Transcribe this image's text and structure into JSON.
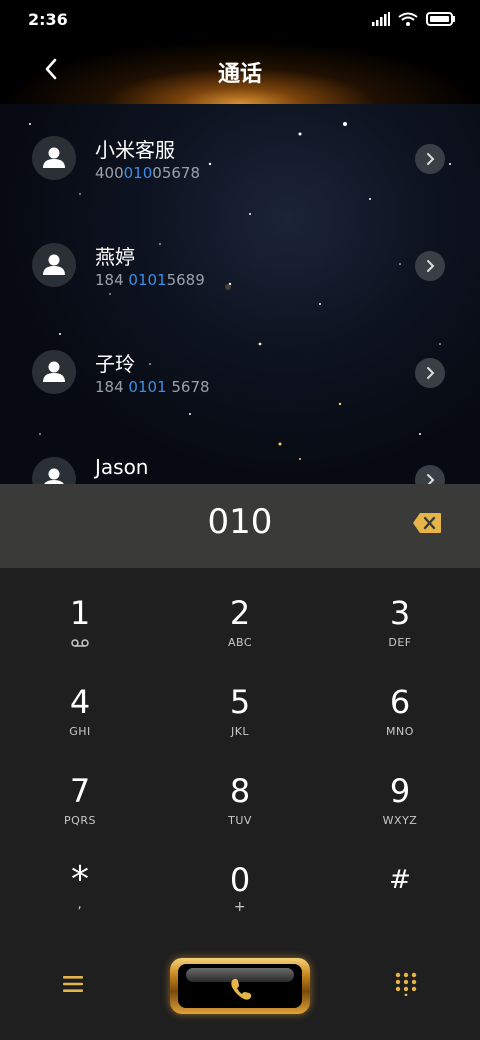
{
  "status": {
    "time": "2:36"
  },
  "header": {
    "title": "通话"
  },
  "contacts": [
    {
      "name": "小米客服",
      "num_pre": "400",
      "num_hl": "010",
      "num_post": "05678"
    },
    {
      "name": "燕婷",
      "num_pre": "184 ",
      "num_hl": "0101",
      "num_post": "5689"
    },
    {
      "name": "子玲",
      "num_pre": "184 ",
      "num_hl": "0101",
      "num_post": " 5678"
    },
    {
      "name": "Jason",
      "num_pre": "",
      "num_hl": "",
      "num_post": ""
    }
  ],
  "dialed": {
    "number": "010"
  },
  "keypad": [
    {
      "digit": "1",
      "letters": ""
    },
    {
      "digit": "2",
      "letters": "ABC"
    },
    {
      "digit": "3",
      "letters": "DEF"
    },
    {
      "digit": "4",
      "letters": "GHI"
    },
    {
      "digit": "5",
      "letters": "JKL"
    },
    {
      "digit": "6",
      "letters": "MNO"
    },
    {
      "digit": "7",
      "letters": "PQRS"
    },
    {
      "digit": "8",
      "letters": "TUV"
    },
    {
      "digit": "9",
      "letters": "WXYZ"
    },
    {
      "digit": "*",
      "letters": ","
    },
    {
      "digit": "0",
      "letters": "+"
    },
    {
      "digit": "#",
      "letters": ""
    }
  ],
  "colors": {
    "highlight": "#3a8ee6",
    "accent_gold": "#e6b54a",
    "keypad_bg": "#1f1f1f",
    "display_bg": "#3a3b39"
  },
  "icons": {
    "back": "chevron-left-icon",
    "avatar": "person-icon",
    "chevron": "chevron-right-icon",
    "backspace": "backspace-icon",
    "voicemail": "voicemail-icon",
    "menu": "menu-icon",
    "call": "phone-icon",
    "dialpad": "dialpad-icon"
  }
}
